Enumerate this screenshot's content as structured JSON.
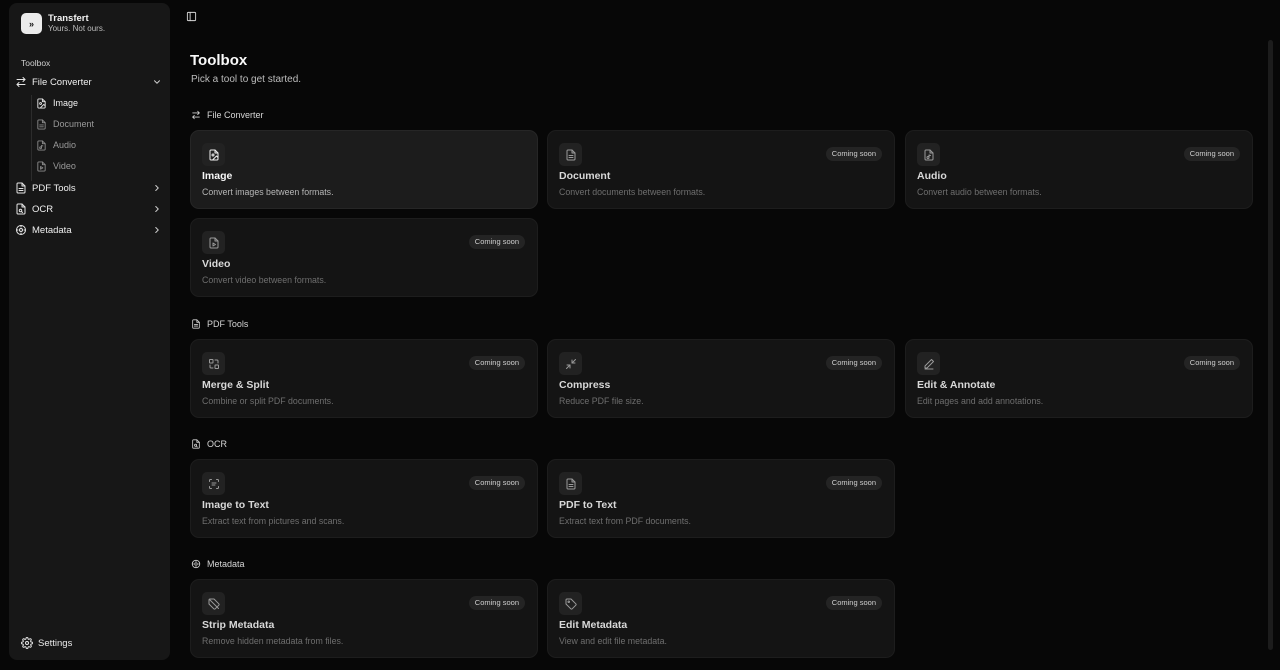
{
  "app": {
    "name": "Transfert",
    "tagline": "Yours. Not ours.",
    "logo_glyph": "»"
  },
  "sidebar": {
    "section": "Toolbox",
    "file_converter": "File Converter",
    "sub_items": [
      "Image",
      "Document",
      "Audio",
      "Video"
    ],
    "pdf_tools": "PDF Tools",
    "ocr": "OCR",
    "metadata": "Metadata",
    "settings": "Settings"
  },
  "main": {
    "title": "Toolbox",
    "subtitle": "Pick a tool to get started.",
    "badge_label": "Coming soon",
    "groups": {
      "file_converter": {
        "heading": "File Converter"
      },
      "pdf_tools": {
        "heading": "PDF Tools"
      },
      "ocr": {
        "heading": "OCR"
      },
      "metadata": {
        "heading": "Metadata"
      }
    },
    "cards": {
      "image": {
        "name": "Image",
        "desc": "Convert images between formats.",
        "icon": "file-image-icon"
      },
      "document": {
        "name": "Document",
        "desc": "Convert documents between formats.",
        "icon": "file-text-icon"
      },
      "audio": {
        "name": "Audio",
        "desc": "Convert audio between formats.",
        "icon": "file-audio-icon"
      },
      "video": {
        "name": "Video",
        "desc": "Convert video between formats.",
        "icon": "file-video-icon"
      },
      "merge_split": {
        "name": "Merge & Split",
        "desc": "Combine or split PDF documents.",
        "icon": "merge-icon"
      },
      "compress": {
        "name": "Compress",
        "desc": "Reduce PDF file size.",
        "icon": "compress-icon"
      },
      "edit_annotate": {
        "name": "Edit & Annotate",
        "desc": "Edit pages and add annotations.",
        "icon": "pen-icon"
      },
      "image_to_text": {
        "name": "Image to Text",
        "desc": "Extract text from pictures and scans.",
        "icon": "scan-text-icon"
      },
      "pdf_to_text": {
        "name": "PDF to Text",
        "desc": "Extract text from PDF documents.",
        "icon": "file-text-icon"
      },
      "strip_metadata": {
        "name": "Strip Metadata",
        "desc": "Remove hidden metadata from files.",
        "icon": "tag-off-icon"
      },
      "edit_metadata": {
        "name": "Edit Metadata",
        "desc": "View and edit file metadata.",
        "icon": "tag-icon"
      }
    }
  },
  "colors": {
    "background": "#070707",
    "sidebar": "#171717",
    "card": "#141414",
    "card_active": "#1c1c1c",
    "text": "#ededed"
  }
}
